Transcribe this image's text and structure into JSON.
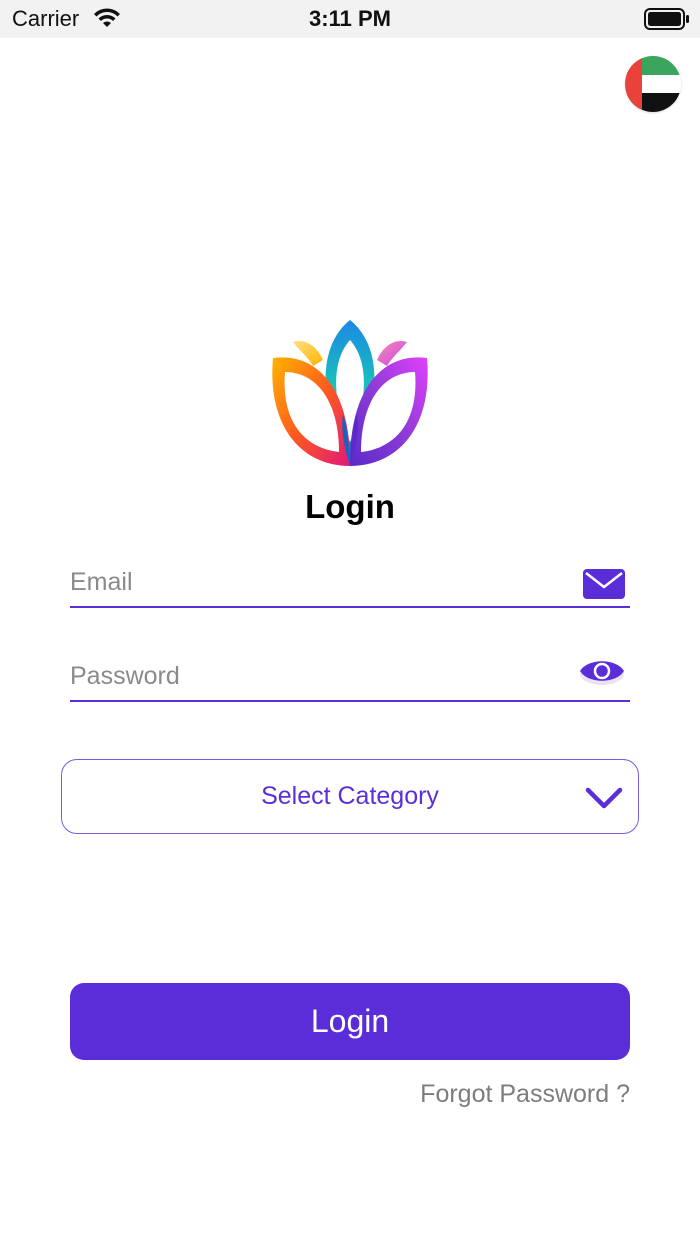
{
  "status_bar": {
    "carrier": "Carrier",
    "time": "3:11 PM"
  },
  "language": {
    "flag": "uae-flag-icon"
  },
  "logo": {
    "name": "lotus-logo"
  },
  "title": "Login",
  "email_field": {
    "placeholder": "Email",
    "value": "",
    "icon": "envelope-icon"
  },
  "password_field": {
    "placeholder": "Password",
    "value": "",
    "icon": "eye-icon"
  },
  "category_select": {
    "label": "Select Category",
    "icon": "chevron-down-icon"
  },
  "login_button": {
    "label": "Login"
  },
  "forgot_password": {
    "label": "Forgot Password ?"
  },
  "colors": {
    "accent": "#5b2dd9",
    "muted_text": "#7d7d7d",
    "status_bar_bg": "#f2f2f2"
  }
}
